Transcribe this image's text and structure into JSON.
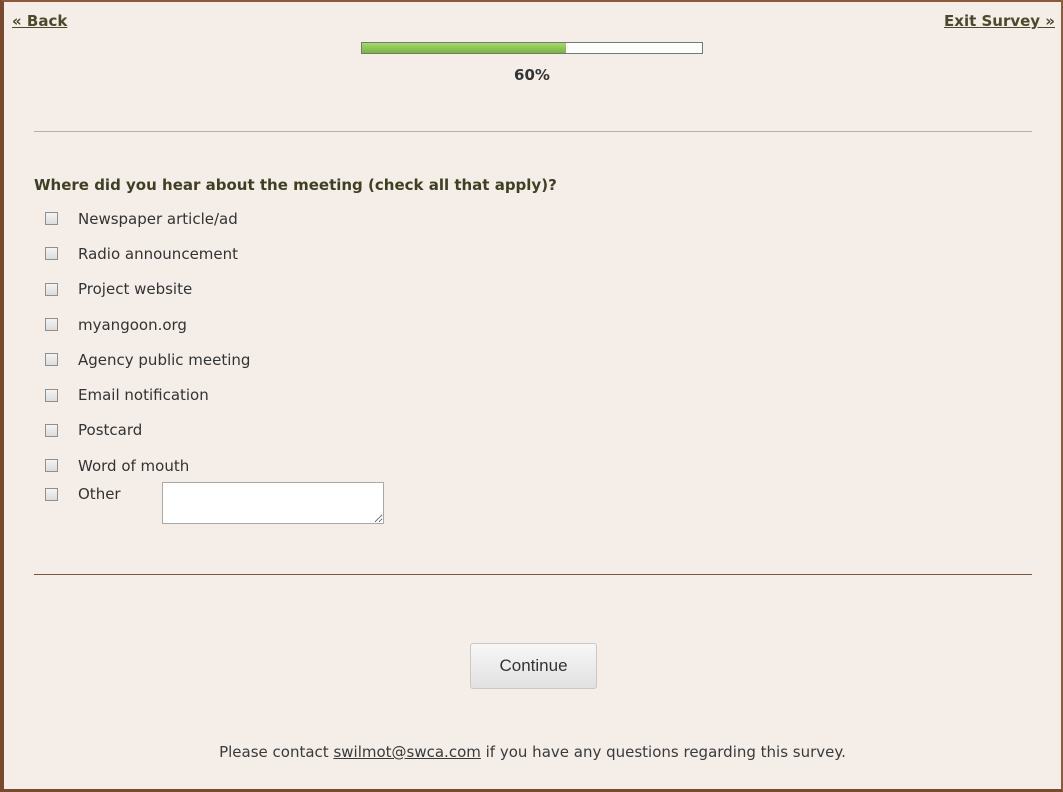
{
  "nav": {
    "back_label": "« Back",
    "exit_label": "Exit Survey »"
  },
  "progress": {
    "percent": 60,
    "label": "60%",
    "fill_color": "#8fc65a"
  },
  "question": {
    "text": "Where did you hear about the meeting (check all that apply)?",
    "options": [
      {
        "label": "Newspaper article/ad",
        "checked": false
      },
      {
        "label": "Radio announcement",
        "checked": false
      },
      {
        "label": "Project website",
        "checked": false
      },
      {
        "label": "myangoon.org",
        "checked": false
      },
      {
        "label": "Agency public meeting",
        "checked": false
      },
      {
        "label": "Email notification",
        "checked": false
      },
      {
        "label": "Postcard",
        "checked": false
      },
      {
        "label": "Word of mouth",
        "checked": false
      }
    ],
    "other": {
      "label": "Other",
      "checked": false,
      "value": ""
    }
  },
  "actions": {
    "continue_label": "Continue"
  },
  "footer": {
    "prefix": "Please contact",
    "email": "swilmot@swca.com",
    "suffix": "if you have any questions regarding this survey."
  },
  "colors": {
    "background": "#f5ede8",
    "frame": "#7a4a2e",
    "progress_fill": "#8fc65a",
    "link": "#4a4a2a"
  }
}
